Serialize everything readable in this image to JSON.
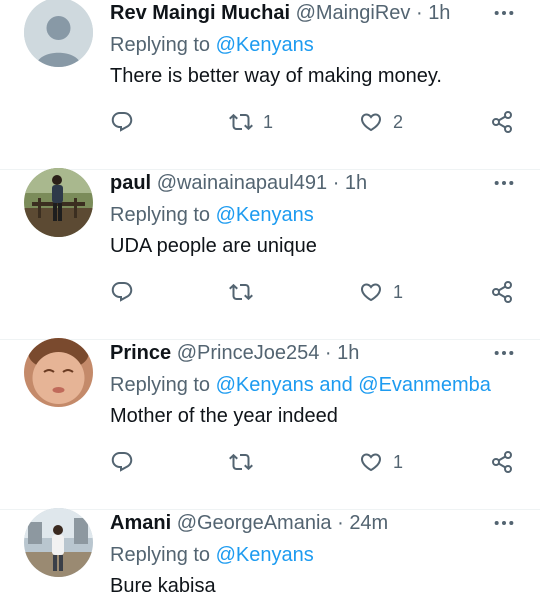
{
  "tweets": [
    {
      "name": "Rev Maingi Muchai",
      "handle": "@MaingiRev",
      "dot": "·",
      "time": "1h",
      "replying_prefix": "Replying to",
      "mention1": "@Kenyans",
      "conj": "",
      "mention2": "",
      "text": "There is better way of making money.",
      "retweets": "1",
      "likes": "2",
      "avatar": "default-avatar-icon"
    },
    {
      "name": "paul",
      "handle": "@wainainapaul491",
      "dot": "·",
      "time": "1h",
      "replying_prefix": "Replying to",
      "mention1": "@Kenyans",
      "conj": "",
      "mention2": "",
      "text": "UDA people are unique",
      "retweets": "",
      "likes": "1",
      "avatar": "photo-avatar"
    },
    {
      "name": "Prince",
      "handle": "@PrinceJoe254",
      "dot": "·",
      "time": "1h",
      "replying_prefix": "Replying to",
      "mention1": "@Kenyans",
      "conj": "and",
      "mention2": "@Evanmemba",
      "text": "Mother of the year indeed",
      "retweets": "",
      "likes": "1",
      "avatar": "photo-avatar"
    },
    {
      "name": "Amani",
      "handle": "@GeorgeAmania",
      "dot": "·",
      "time": "24m",
      "replying_prefix": "Replying to",
      "mention1": "@Kenyans",
      "conj": "",
      "mention2": "",
      "text": "Bure kabisa",
      "retweets": "",
      "likes": "",
      "avatar": "photo-avatar"
    }
  ],
  "colors": {
    "link": "#1d9bf0",
    "secondary": "#536471",
    "primary": "#0f1419",
    "divider": "#eff3f4"
  },
  "icons": [
    "more-icon",
    "reply-icon",
    "retweet-icon",
    "like-icon",
    "share-icon"
  ]
}
